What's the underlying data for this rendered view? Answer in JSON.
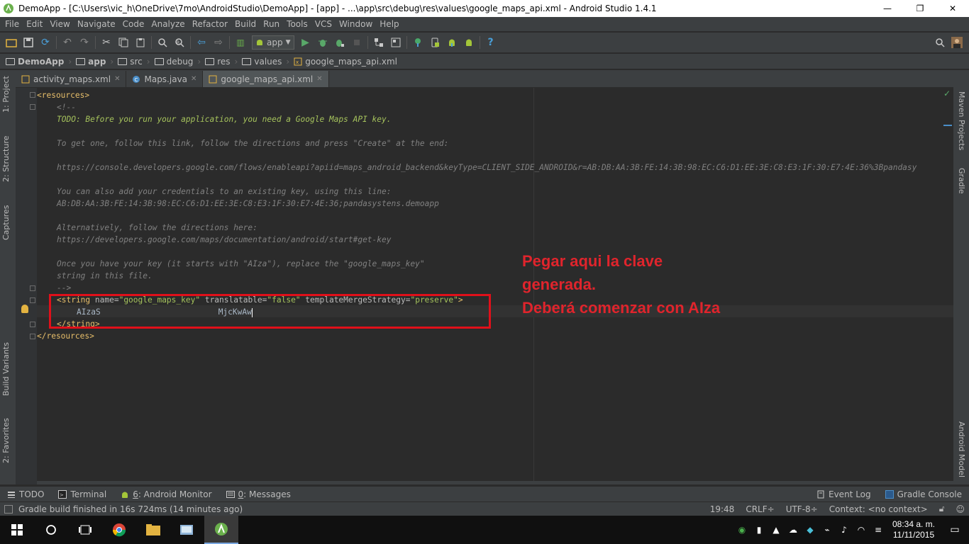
{
  "window": {
    "title": "DemoApp - [C:\\Users\\vic_h\\OneDrive\\7mo\\AndroidStudio\\DemoApp] - [app] - ...\\app\\src\\debug\\res\\values\\google_maps_api.xml - Android Studio 1.4.1",
    "minimize": "—",
    "restore": "❐",
    "close": "✕"
  },
  "menu": [
    "File",
    "Edit",
    "View",
    "Navigate",
    "Code",
    "Analyze",
    "Refactor",
    "Build",
    "Run",
    "Tools",
    "VCS",
    "Window",
    "Help"
  ],
  "toolbar": {
    "run_config": "app",
    "help": "?"
  },
  "breadcrumb": [
    "DemoApp",
    "app",
    "src",
    "debug",
    "res",
    "values",
    "google_maps_api.xml"
  ],
  "tabs": [
    {
      "label": "activity_maps.xml"
    },
    {
      "label": "Maps.java"
    },
    {
      "label": "google_maps_api.xml"
    }
  ],
  "left_strip": [
    "1: Project",
    "2: Structure",
    "Captures",
    "Build Variants",
    "2: Favorites"
  ],
  "right_strip": [
    "Maven Projects",
    "Gradle",
    "Android Model"
  ],
  "editor": {
    "lines": {
      "l1_tag": "<resources>",
      "l2": "<!--",
      "l3": "TODO: Before you run your application, you need a Google Maps API key.",
      "l5": "To get one, follow this link, follow the directions and press \"Create\" at the end:",
      "l7": "https://console.developers.google.com/flows/enableapi?apiid=maps_android_backend&keyType=CLIENT_SIDE_ANDROID&r=AB:DB:AA:3B:FE:14:3B:98:EC:C6:D1:EE:3E:C8:E3:1F:30:E7:4E:36%3Bpandasy",
      "l9": "You can also add your credentials to an existing key, using this line:",
      "l10": "AB:DB:AA:3B:FE:14:3B:98:EC:C6:D1:EE:3E:C8:E3:1F:30:E7:4E:36;pandasystens.demoapp",
      "l12": "Alternatively, follow the directions here:",
      "l13": "https://developers.google.com/maps/documentation/android/start#get-key",
      "l15": "Once you have your key (it starts with \"AIza\"), replace the \"google_maps_key\"",
      "l16": "string in this file.",
      "l17": "-->",
      "l18_open": "<string ",
      "l18_a1": "name=",
      "l18_v1": "\"google_maps_key\"",
      "l18_a2": " translatable=",
      "l18_v2": "\"false\"",
      "l18_a3": " templateMergeStrategy=",
      "l18_v3": "\"preserve\"",
      "l18_close": ">",
      "l19_key_start": "AIzaS",
      "l19_key_end": "MjcKwAw",
      "l20": "</string>",
      "l21": "</resources>"
    }
  },
  "annotation": {
    "line1": "Pegar aqui la clave",
    "line2": "generada.",
    "line3": "Deberá comenzar con AIza"
  },
  "bottom_tabs": {
    "todo": "TODO",
    "terminal": "Terminal",
    "android_monitor_num": "6",
    "android_monitor": ": Android Monitor",
    "messages_num": "0",
    "messages": ": Messages",
    "event_log": "Event Log",
    "gradle_console": "Gradle Console"
  },
  "status": {
    "message": "Gradle build finished in 16s 724ms (14 minutes ago)",
    "position": "19:48",
    "line_sep": "CRLF÷",
    "encoding": "UTF-8÷",
    "context": "Context: <no context>"
  },
  "taskbar": {
    "time": "08:34 a. m.",
    "date": "11/11/2015"
  },
  "colors": {
    "ide_bg": "#2b2b2b",
    "panel_bg": "#3c3f41",
    "annotation_red": "#e0242c",
    "android_green": "#a4c639"
  }
}
